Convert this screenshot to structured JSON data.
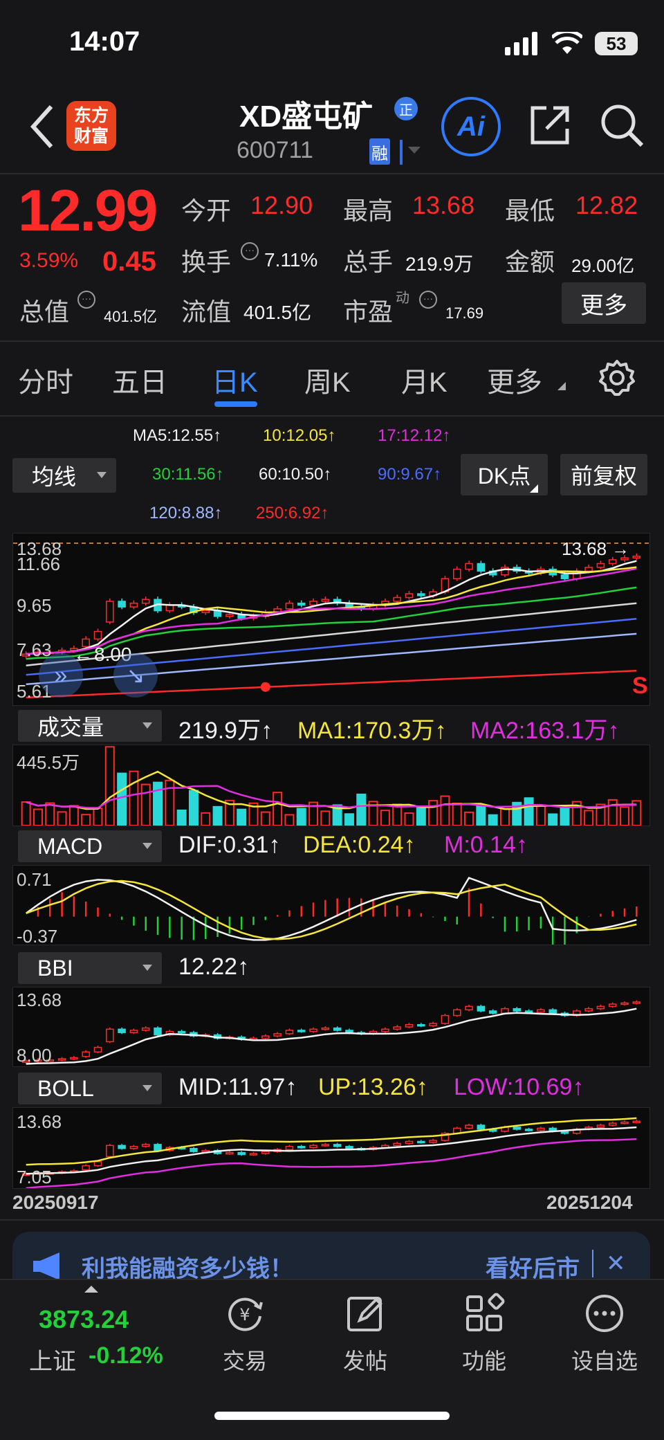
{
  "status": {
    "time": "14:07",
    "battery": "53"
  },
  "header": {
    "logo_line1": "东方",
    "logo_line2": "财富",
    "stock_name": "XD盛屯矿",
    "badge": "正",
    "code": "600711",
    "margin_tag": "融",
    "ai_label": "Ai"
  },
  "quote": {
    "price": "12.99",
    "change_pct": "3.59%",
    "change": "0.45",
    "open_label": "今开",
    "open": "12.90",
    "high_label": "最高",
    "high": "13.68",
    "low_label": "最低",
    "low": "12.82",
    "turnover_label": "换手",
    "turnover": "7.11%",
    "volume_label": "总手",
    "volume": "219.9万",
    "amount_label": "金额",
    "amount": "29.00亿",
    "mktcap_label": "总值",
    "mktcap": "401.5亿",
    "float_label": "流值",
    "float": "401.5亿",
    "pe_label": "市盈",
    "pe_sup": "动",
    "pe": "17.69",
    "more": "更多"
  },
  "tabs": [
    "分时",
    "五日",
    "日K",
    "周K",
    "月K",
    "更多"
  ],
  "active_tab": "日K",
  "ma": {
    "select": "均线",
    "dk": "DK点",
    "fq": "前复权",
    "ma5": "MA5:12.55",
    "ma10": "10:12.05",
    "ma17": "17:12.12",
    "ma30": "30:11.56",
    "ma60": "60:10.50",
    "ma90": "90:9.67",
    "ma120": "120:8.88",
    "ma250": "250:6.92",
    "arrow": "↑",
    "colors": {
      "ma5": "#f2f2f2",
      "ma10": "#f5e63a",
      "ma17": "#e02ee0",
      "ma30": "#22d03a",
      "ma60": "#d8d8d8",
      "ma90": "#4a6cff",
      "ma120": "#9fb8ff",
      "ma250": "#ff2a2a"
    }
  },
  "kchart": {
    "top": "13.68",
    "y1": "11.66",
    "y2": "9.65",
    "y3": "7.63",
    "bottom": "5.61",
    "high_mark": "13.68",
    "low_mark": "8.00",
    "s_mark": "S"
  },
  "volume": {
    "select": "成交量",
    "total": "219.9万↑",
    "ma1": "MA1:170.3万↑",
    "ma2": "MA2:163.1万↑",
    "axis": "445.5万"
  },
  "macd": {
    "select": "MACD",
    "dif": "DIF:0.31↑",
    "dea": "DEA:0.24↑",
    "m": "M:0.14↑",
    "top": "0.71",
    "bottom": "-0.37"
  },
  "bbi": {
    "select": "BBI",
    "value": "12.22↑",
    "top": "13.68",
    "bottom": "8.00"
  },
  "boll": {
    "select": "BOLL",
    "mid": "MID:11.97↑",
    "up": "UP:13.26↑",
    "low": "LOW:10.69↑",
    "top": "13.68",
    "bottom": "7.05"
  },
  "dates": {
    "start": "20250917",
    "end": "20251204"
  },
  "banner": {
    "text": "利我能融资多少钱！",
    "right": "看好后市"
  },
  "bottom_nav": {
    "index_value": "3873.24",
    "index_name": "上证",
    "index_change": "-0.12%",
    "items": [
      "交易",
      "发帖",
      "功能",
      "设自选"
    ]
  },
  "chart_data": {
    "type": "candlestick",
    "closes": [
      7.8,
      7.9,
      7.9,
      8.0,
      8.1,
      8.6,
      9.0,
      10.6,
      10.3,
      10.5,
      10.7,
      10.1,
      10.4,
      10.3,
      10.0,
      10.1,
      9.8,
      9.9,
      9.7,
      9.8,
      10.0,
      10.2,
      10.5,
      10.4,
      10.6,
      10.7,
      10.5,
      10.3,
      10.2,
      10.4,
      10.6,
      10.8,
      11.0,
      10.9,
      11.1,
      11.8,
      12.3,
      12.6,
      12.2,
      12.0,
      12.4,
      12.2,
      12.1,
      12.3,
      12.0,
      11.8,
      12.2,
      12.4,
      12.6,
      12.8,
      12.9,
      12.99
    ],
    "opens": [
      7.7,
      7.8,
      7.9,
      7.9,
      8.0,
      8.2,
      8.6,
      9.5,
      10.6,
      10.3,
      10.5,
      10.7,
      10.1,
      10.4,
      10.3,
      10.0,
      10.1,
      9.8,
      9.9,
      9.7,
      9.8,
      10.0,
      10.2,
      10.5,
      10.4,
      10.6,
      10.7,
      10.5,
      10.3,
      10.2,
      10.4,
      10.6,
      10.8,
      11.0,
      10.9,
      11.1,
      11.8,
      12.3,
      12.6,
      12.2,
      12.0,
      12.4,
      12.2,
      12.1,
      12.3,
      12.0,
      11.8,
      12.2,
      12.4,
      12.6,
      12.8,
      12.9
    ],
    "ymin": 5.61,
    "ymax": 13.68
  }
}
